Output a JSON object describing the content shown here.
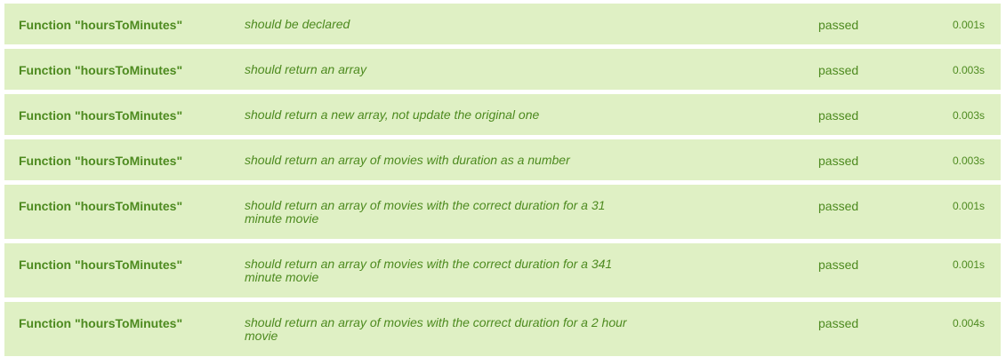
{
  "tests": [
    {
      "suite": "Function \"hoursToMinutes\"",
      "description": "should be declared",
      "status": "passed",
      "time": "0.001s"
    },
    {
      "suite": "Function \"hoursToMinutes\"",
      "description": "should return an array",
      "status": "passed",
      "time": "0.003s"
    },
    {
      "suite": "Function \"hoursToMinutes\"",
      "description": "should return a new array, not update the original one",
      "status": "passed",
      "time": "0.003s"
    },
    {
      "suite": "Function \"hoursToMinutes\"",
      "description": "should return an array of movies with duration as a number",
      "status": "passed",
      "time": "0.003s"
    },
    {
      "suite": "Function \"hoursToMinutes\"",
      "description": "should return an array of movies with the correct duration for a 31 minute movie",
      "status": "passed",
      "time": "0.001s"
    },
    {
      "suite": "Function \"hoursToMinutes\"",
      "description": "should return an array of movies with the correct duration for a 341 minute movie",
      "status": "passed",
      "time": "0.001s"
    },
    {
      "suite": "Function \"hoursToMinutes\"",
      "description": "should return an array of movies with the correct duration for a 2 hour movie",
      "status": "passed",
      "time": "0.004s"
    }
  ]
}
